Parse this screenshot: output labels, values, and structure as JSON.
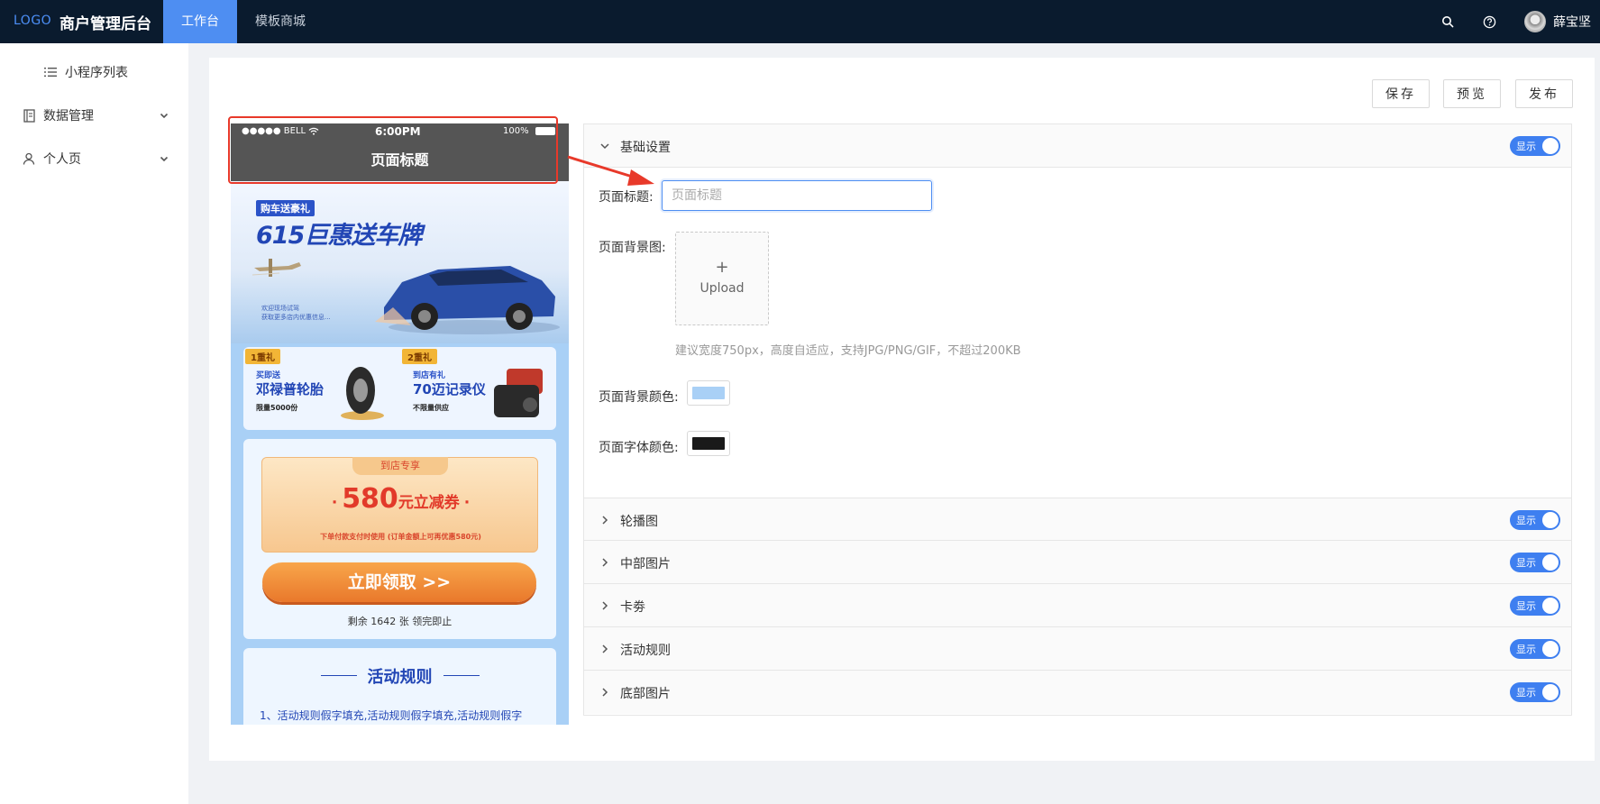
{
  "topbar": {
    "logo": "LOGO",
    "app_title": "商户管理后台",
    "tabs": [
      {
        "label": "工作台",
        "active": true
      },
      {
        "label": "模板商城",
        "active": false
      }
    ],
    "icons": [
      "search-icon",
      "help-icon"
    ],
    "user_name": "薛宝坚"
  },
  "sidebar": {
    "items": [
      {
        "label": "小程序列表",
        "icon": "list-icon"
      },
      {
        "label": "数据管理",
        "icon": "book-icon"
      },
      {
        "label": "个人页",
        "icon": "user-icon"
      }
    ]
  },
  "actions": {
    "save": "保存",
    "preview": "预览",
    "publish": "发布"
  },
  "phone": {
    "status_carrier": "●●●●● BELL",
    "status_time": "6:00PM",
    "status_battery": "100%",
    "header_title": "页面标题",
    "banner": {
      "tag": "购车送豪礼",
      "title_a": "615巨惠",
      "title_b": "送车牌",
      "small_1": "欢迎现场试驾",
      "small_2": "获取更多店内优惠信息..."
    },
    "gifts": [
      {
        "tag": "1重礼",
        "sub": "买即送",
        "name": "邓禄普轮胎",
        "note": "限量5000份"
      },
      {
        "tag": "2重礼",
        "sub": "到店有礼",
        "name": "70迈记录仪",
        "note": "不限量供应"
      }
    ],
    "coupon": {
      "tag": "到店专享",
      "dot": "·",
      "amount": "580",
      "amount_text": "元立减券",
      "note": "下单付款支付时使用 (订单金额上可再优惠580元)",
      "button": "立即领取 >>",
      "remaining": "剩余 1642 张 领完即止"
    },
    "rules": {
      "title": "活动规则",
      "text": "1、活动规则假字填充,活动规则假字填充,活动规则假字"
    }
  },
  "settings": {
    "basic": {
      "title": "基础设置",
      "toggle": "显示",
      "page_title_label": "页面标题:",
      "page_title_placeholder": "页面标题",
      "bg_image_label": "页面背景图:",
      "upload_plus": "+",
      "upload_label": "Upload",
      "hint": "建议宽度750px，高度自适应，支持JPG/PNG/GIF，不超过200KB",
      "bg_color_label": "页面背景颜色:",
      "font_color_label": "页面字体颜色:",
      "bg_color": "#a9d0f6",
      "font_color": "#1a1a1a"
    },
    "sections": [
      {
        "title": "轮播图",
        "toggle": "显示"
      },
      {
        "title": "中部图片",
        "toggle": "显示"
      },
      {
        "title": "卡劵",
        "toggle": "显示"
      },
      {
        "title": "活动规则",
        "toggle": "显示"
      },
      {
        "title": "底部图片",
        "toggle": "显示"
      }
    ]
  },
  "colors": {
    "topbar": "#0a1b2e",
    "accent": "#4e8ef2",
    "annotation": "#e8392a"
  }
}
